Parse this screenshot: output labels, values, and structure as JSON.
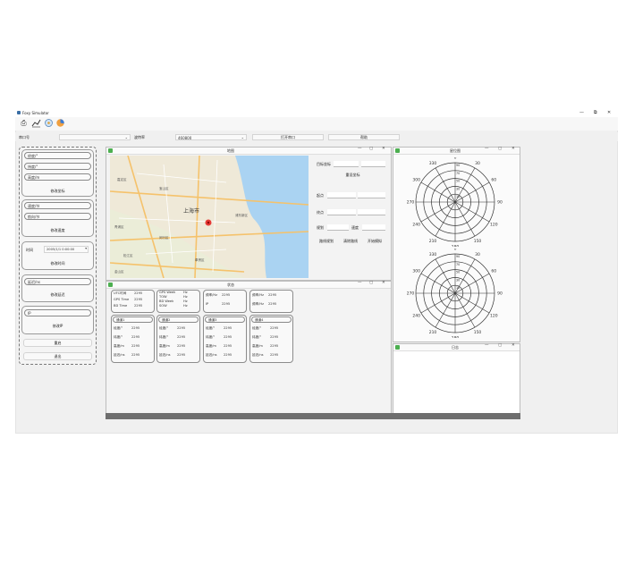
{
  "window": {
    "title": "Foxy Simulator",
    "minimize_icon": "minimize-icon",
    "maximize_icon": "maximize-icon",
    "close_icon": "close-icon"
  },
  "toolbar": {
    "icons": [
      "print-icon",
      "chart-line-icon",
      "satellite-icon",
      "pie-chart-icon"
    ]
  },
  "settings": {
    "port_label": "串口号",
    "port_value": "",
    "baud_label": "波特率",
    "baud_value": "460800",
    "open_port_button": "打开串口",
    "help_button": "帮助"
  },
  "left_panel": {
    "position": {
      "lon": "经度/°",
      "lat": "纬度/°",
      "alt": "高度/m",
      "button": "修改坐标"
    },
    "speed": {
      "speed": "速度/节",
      "course": "航向/节",
      "button": "修改速度"
    },
    "time": {
      "label": "时间",
      "value": "2005/1/1 0:00:00",
      "button": "修改时间"
    },
    "delay": {
      "field": "延迟/ns",
      "button": "修改延迟"
    },
    "ip": {
      "field": "IP",
      "button": "修改IP"
    },
    "save_button": "重启",
    "exit_button": "退出"
  },
  "map_window": {
    "title": "地图",
    "city": "上海市",
    "places": [
      "宝山区",
      "嘉定区",
      "青浦区",
      "闵行区",
      "松江区",
      "浦东新区",
      "奉贤区",
      "金山区"
    ],
    "target_coord_label": "目标坐标",
    "apply_coord_button": "重设坐标",
    "start_label": "起点",
    "end_label": "终点",
    "rows_label": "规划",
    "speed_label": "速度",
    "buttons": [
      "路线规划",
      "清除路线",
      "开始模拟"
    ]
  },
  "info_window": {
    "title": "状态",
    "time_card": [
      {
        "label": "UTC时间",
        "value": "2295"
      },
      {
        "label": "GPS Time",
        "value": "2295"
      },
      {
        "label": "BD Time",
        "value": "2295"
      }
    ],
    "week_card": [
      {
        "label": "GPS Week",
        "value": "Hz"
      },
      {
        "label": "TOW",
        "value": "Hz"
      },
      {
        "label": "BD Week",
        "value": "Hz"
      },
      {
        "label": "SOW",
        "value": "Hz"
      }
    ],
    "rate_card": [
      {
        "label": "频率/Hz",
        "value": "2295"
      },
      {
        "label": "IP",
        "value": "2295"
      }
    ],
    "misc_card": [
      {
        "label": "频率/Hz",
        "value": "2295"
      },
      {
        "label": "频率/Hz",
        "value": "2295"
      }
    ],
    "sat_cards": [
      {
        "header": "通道1",
        "rows": [
          {
            "label": "经度/°",
            "value": "2295"
          },
          {
            "label": "纬度/°",
            "value": "2295"
          },
          {
            "label": "高度/m",
            "value": "2295"
          },
          {
            "label": "延迟/ns",
            "value": "2295"
          }
        ]
      },
      {
        "header": "通道2",
        "rows": [
          {
            "label": "经度/°",
            "value": "2295"
          },
          {
            "label": "纬度/°",
            "value": "2295"
          },
          {
            "label": "高度/m",
            "value": "2295"
          },
          {
            "label": "延迟/ns",
            "value": "2295"
          }
        ]
      },
      {
        "header": "通道3",
        "rows": [
          {
            "label": "经度/°",
            "value": "2295"
          },
          {
            "label": "纬度/°",
            "value": "2295"
          },
          {
            "label": "高度/m",
            "value": "2295"
          },
          {
            "label": "延迟/ns",
            "value": "2295"
          }
        ]
      },
      {
        "header": "通道4",
        "rows": [
          {
            "label": "经度/°",
            "value": "2295"
          },
          {
            "label": "纬度/°",
            "value": "2295"
          },
          {
            "label": "高度/m",
            "value": "2295"
          },
          {
            "label": "延迟/ns",
            "value": "2295"
          }
        ]
      }
    ]
  },
  "sky_window": {
    "title": "星位图",
    "bearing_labels": [
      "0",
      "30",
      "60",
      "90",
      "120",
      "150",
      "180",
      "210",
      "240",
      "270",
      "300",
      "330"
    ],
    "ring_labels": [
      "10",
      "30",
      "50",
      "70",
      "90"
    ]
  },
  "log_window": {
    "title": "日志"
  }
}
